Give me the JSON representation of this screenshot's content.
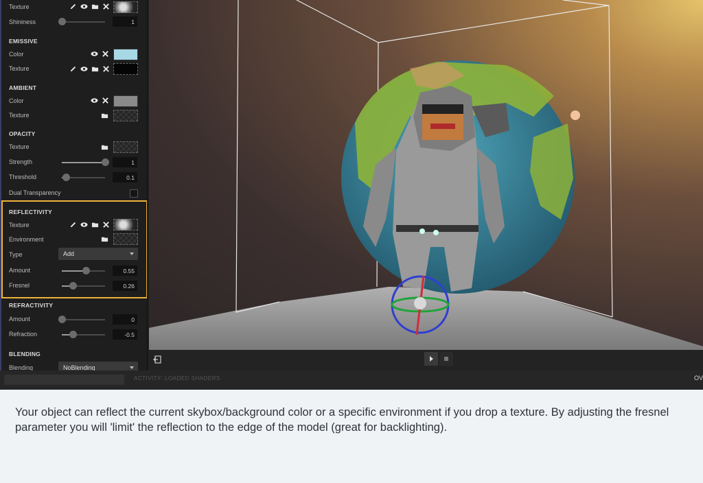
{
  "panel": {
    "specular": {
      "texture_label": "Texture",
      "shininess_label": "Shininess",
      "shininess_value": "1"
    },
    "emissive": {
      "header": "EMISSIVE",
      "color_label": "Color",
      "color_value": "#a7d8e6",
      "texture_label": "Texture"
    },
    "ambient": {
      "header": "AMBIENT",
      "color_label": "Color",
      "color_value": "#8a8a8a",
      "texture_label": "Texture"
    },
    "opacity": {
      "header": "OPACITY",
      "texture_label": "Texture",
      "strength_label": "Strength",
      "strength_value": "1",
      "threshold_label": "Threshold",
      "threshold_value": "0.1",
      "dual_label": "Dual Transparency"
    },
    "reflectivity": {
      "header": "REFLECTIVITY",
      "texture_label": "Texture",
      "environment_label": "Environment",
      "type_label": "Type",
      "type_value": "Add",
      "amount_label": "Amount",
      "amount_value": "0.55",
      "fresnel_label": "Fresnel",
      "fresnel_value": "0.26"
    },
    "refractivity": {
      "header": "REFRACTIVITY",
      "amount_label": "Amount",
      "amount_value": "0",
      "refraction_label": "Refraction",
      "refraction_value": "-0.5"
    },
    "blending": {
      "header": "BLENDING",
      "blending_label": "Blending",
      "blending_value": "NoBlending"
    }
  },
  "slider_levels": {
    "shininess": 0.0,
    "strength": 1.0,
    "threshold": 0.1,
    "amount": 0.55,
    "fresnel": 0.26,
    "refr_amount": 0.0,
    "refraction": 0.25
  },
  "statusbar": {
    "activity_text": "ACTIVITY: LOADED SHADERS",
    "right_text": "OV"
  },
  "colors": {
    "highlight": "#f0b23a",
    "panel_bg": "#1e1e1e"
  },
  "icons": [
    "pencil-icon",
    "eye-icon",
    "folder-icon",
    "close-icon",
    "exit-icon",
    "play-icon",
    "stop-icon"
  ],
  "description": "Your object can reflect the current skybox/background color or a specific environment if you drop a texture. By adjusting the fresnel parameter you will 'limit' the reflection to the edge of the model (great for backlighting)."
}
